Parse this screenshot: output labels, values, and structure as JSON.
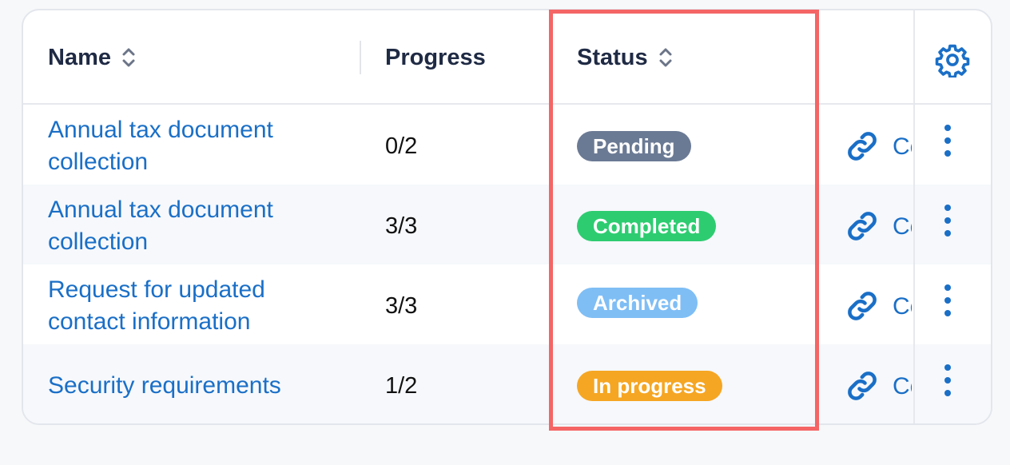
{
  "headers": {
    "name": "Name",
    "progress": "Progress",
    "status": "Status"
  },
  "icons": {
    "sort": "sort-icon",
    "settings": "gear-icon",
    "link": "link-icon",
    "more": "more-vertical-icon"
  },
  "colors": {
    "link": "#1a6fc7",
    "pending": "#6b7a94",
    "completed": "#2ecc71",
    "archived": "#7fbef5",
    "in_progress": "#f5a623",
    "highlight": "#f56565"
  },
  "rows": [
    {
      "name": "Annual tax document collection",
      "progress": "0/2",
      "status": "Pending",
      "action": "Co"
    },
    {
      "name": "Annual tax document collection",
      "progress": "3/3",
      "status": "Completed",
      "action": "Co"
    },
    {
      "name": "Request for updated contact information",
      "progress": "3/3",
      "status": "Archived",
      "action": "Co"
    },
    {
      "name": "Security requirements",
      "progress": "1/2",
      "status": "In progress",
      "action": "Co"
    }
  ]
}
